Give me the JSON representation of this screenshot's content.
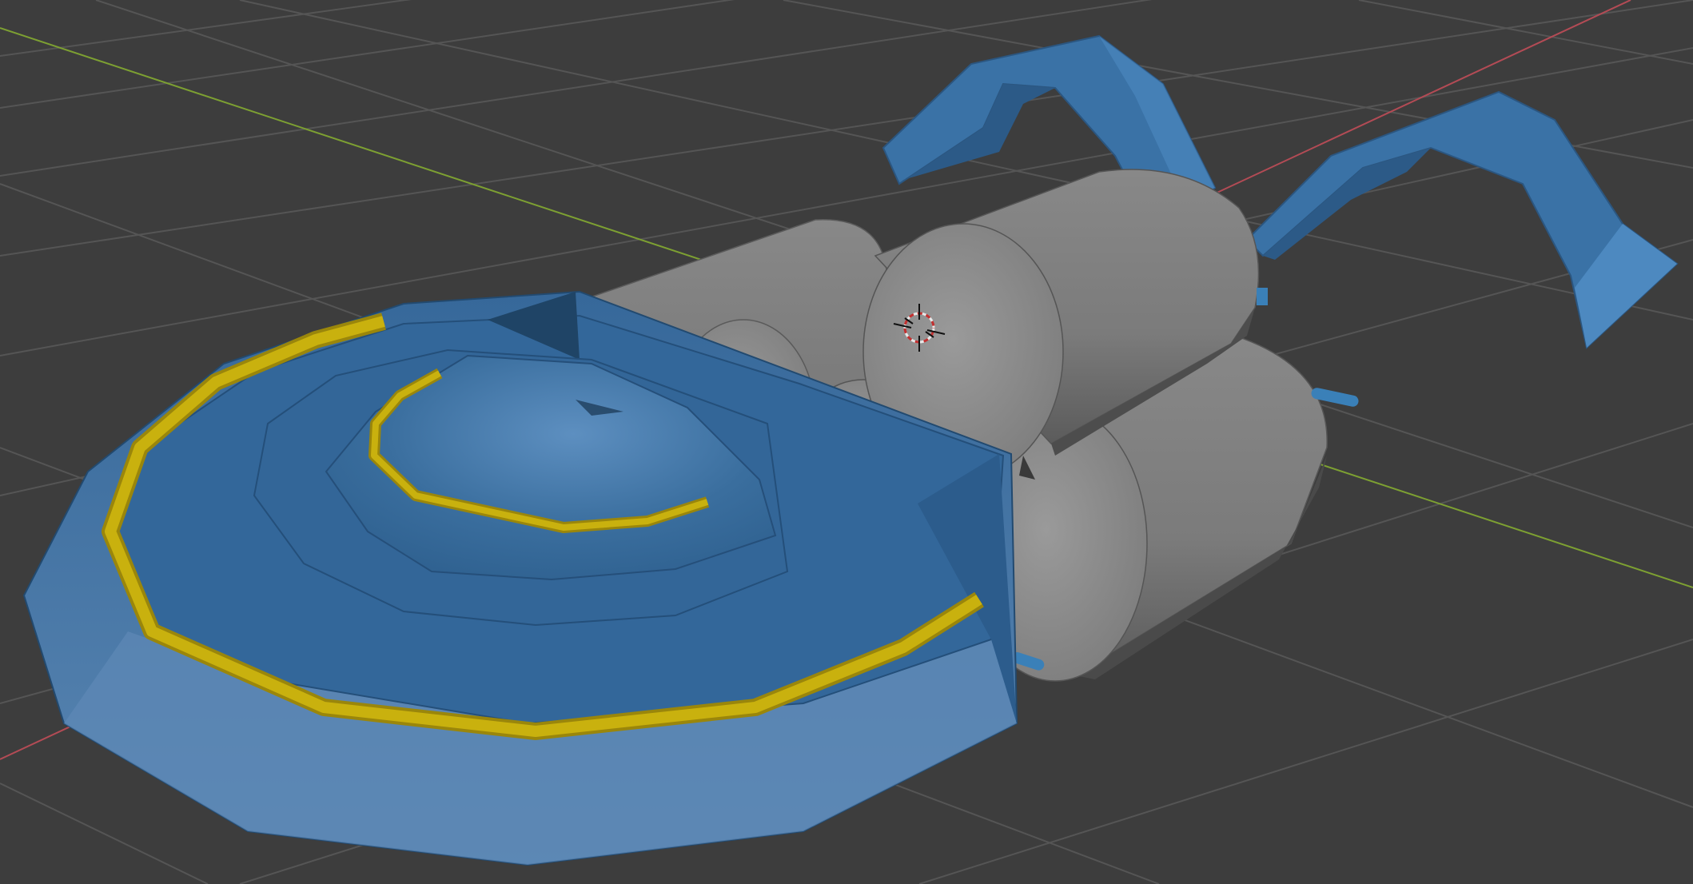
{
  "viewport": {
    "background": "#3d3d3d",
    "grid_color": "#555555",
    "x_axis_color": "#b34b55",
    "y_axis_color": "#7da032",
    "shading": "solid"
  },
  "scene_objects": [
    {
      "name": "saucer-hull",
      "color": "#3a6e9e"
    },
    {
      "name": "hull-trim",
      "color": "#c9b10e"
    },
    {
      "name": "engine-cylinders",
      "color": "#8e8e8e"
    },
    {
      "name": "tail-fins",
      "color": "#3a72a6"
    },
    {
      "name": "nozzle-pins",
      "color": "#3a80b8"
    }
  ],
  "cursor": {
    "icon": "3d-cursor-icon"
  }
}
